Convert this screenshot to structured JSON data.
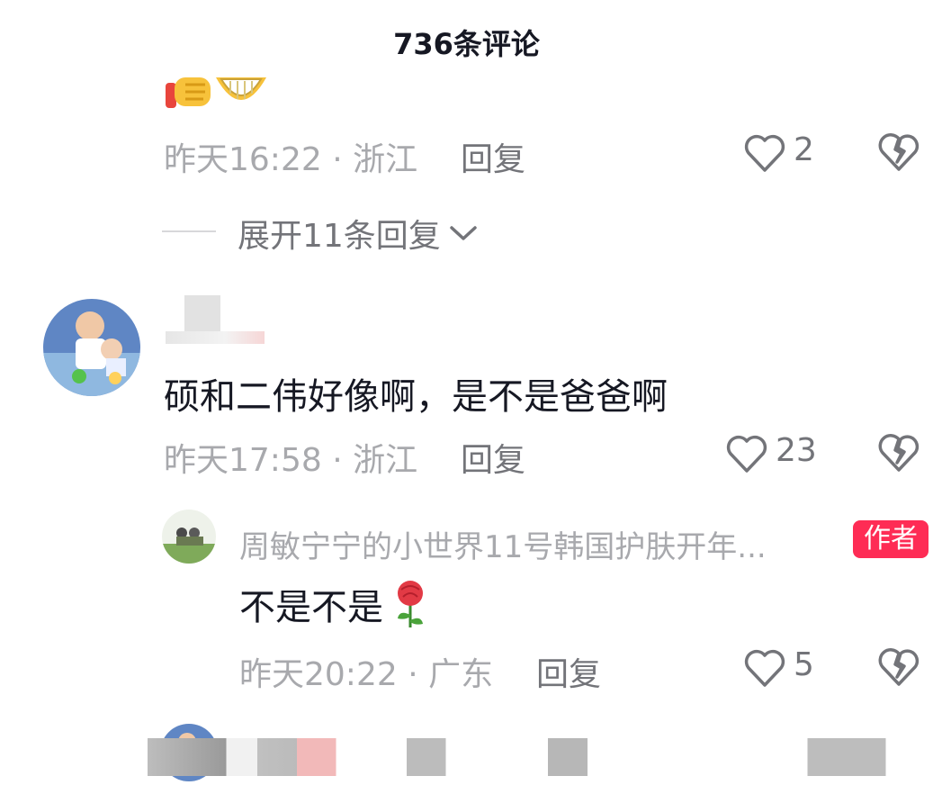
{
  "header": {
    "title": "736条评论"
  },
  "comment1": {
    "meta": "昨天16:22 · 浙江",
    "reply_label": "回复",
    "likes": "2",
    "expand_label": "展开11条回复"
  },
  "comment2": {
    "text": "硕和二伟好像啊，是不是爸爸啊",
    "meta": "昨天17:58 · 浙江",
    "reply_label": "回复",
    "likes": "23"
  },
  "reply1": {
    "author": "周敏宁宁的小世界11号韩国护肤开年...",
    "badge": "作者",
    "text": "不是不是",
    "meta": "昨天20:22 · 广东",
    "reply_label": "回复",
    "likes": "5"
  },
  "colors": {
    "badge": "#fe2c55",
    "meta": "#a8a9ad",
    "text": "#161823"
  },
  "icons": [
    "thumbs-up-emoji",
    "grin-emoji",
    "heart-icon",
    "broken-heart-icon",
    "chevron-down-icon",
    "rose-emoji"
  ]
}
